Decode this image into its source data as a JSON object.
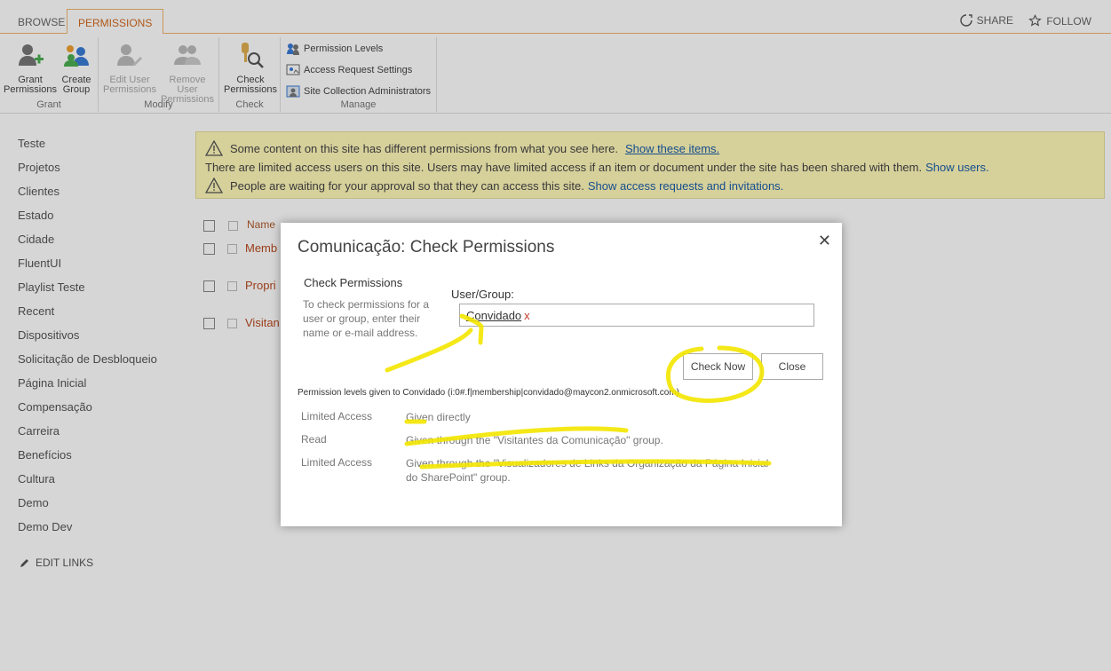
{
  "ribbon": {
    "tabs": [
      "BROWSE",
      "PERMISSIONS"
    ],
    "share": "SHARE",
    "follow": "FOLLOW",
    "groups": {
      "grant": {
        "label": "Grant",
        "grant_permissions": [
          "Grant",
          "Permissions"
        ],
        "create_group": [
          "Create",
          "Group"
        ]
      },
      "modify": {
        "label": "Modify",
        "edit_user": [
          "Edit User",
          "Permissions"
        ],
        "remove_user": [
          "Remove User",
          "Permissions"
        ]
      },
      "check": {
        "label": "Check",
        "check_permissions": [
          "Check",
          "Permissions"
        ]
      },
      "manage": {
        "label": "Manage",
        "items": [
          "Permission Levels",
          "Access Request Settings",
          "Site Collection Administrators"
        ]
      }
    }
  },
  "nav": {
    "items": [
      "Teste",
      "Projetos",
      "Clientes",
      "Estado",
      "Cidade",
      "FluentUI",
      "Playlist Teste",
      "Recent",
      "Dispositivos",
      "Solicitação de Desbloqueio",
      "Página Inicial",
      "Compensação",
      "Carreira",
      "Benefícios",
      "Cultura",
      "Demo",
      "Demo Dev"
    ],
    "edit_links": "EDIT LINKS"
  },
  "banner": {
    "line1_text": "Some content on this site has different permissions from what you see here.",
    "line1_link": "Show these items.",
    "line2_text": "There are limited access users on this site. Users may have limited access if an item or document under the site has been shared with them.",
    "line2_link": "Show users.",
    "line3_text": "People are waiting for your approval so that they can access this site.",
    "line3_link": "Show access requests and invitations."
  },
  "list": {
    "header_name": "Name",
    "rows": [
      "Memb",
      "Propri",
      "Visitan"
    ]
  },
  "dialog": {
    "title": "Comunicação: Check Permissions",
    "section_title": "Check Permissions",
    "section_desc": "To check permissions for a user or group, enter their name or e-mail address.",
    "user_group_label": "User/Group:",
    "user_group_value": "Convidado",
    "remove_glyph": "x",
    "check_now": "Check Now",
    "close": "Close",
    "result_label": "Permission levels given to Convidado (i:0#.f|membership|convidado@maycon2.onmicrosoft.com)",
    "results": [
      {
        "level": "Limited Access",
        "source": "Given directly"
      },
      {
        "level": "Read",
        "source": "Given through the \"Visitantes da Comunicação\" group."
      },
      {
        "level": "Limited Access",
        "source": "Given through the \"Visualizadores de Links da Organização da Página Inicial do SharePoint\" group."
      }
    ]
  },
  "colors": {
    "accent": "#d2691e",
    "banner_bg": "#fff8b9",
    "link": "#1a5ea8",
    "highlighter": "#f3e600"
  },
  "icons": [
    "share-icon",
    "star-icon",
    "grant-permissions-icon",
    "create-group-icon",
    "edit-user-icon",
    "remove-user-icon",
    "check-permissions-icon",
    "permission-levels-icon",
    "access-request-icon",
    "site-admins-icon",
    "warning-icon",
    "pencil-icon",
    "close-icon"
  ]
}
